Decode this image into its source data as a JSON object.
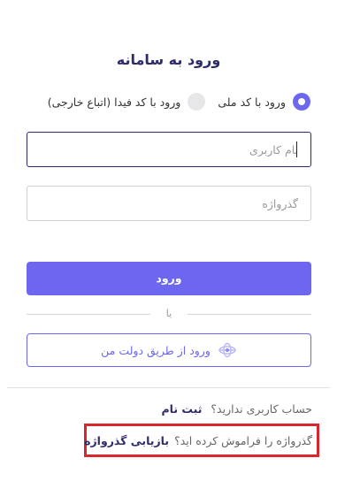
{
  "login": {
    "title": "ورود به سامانه",
    "radio_options": [
      {
        "label": "ورود با کد ملی",
        "selected": true
      },
      {
        "label": "ورود با کد فیدا (اتباع خارجی)",
        "selected": false
      }
    ],
    "username_placeholder": "نام کاربری",
    "password_placeholder": "گذرواژه",
    "submit_label": "ورود",
    "divider_text": "یا",
    "gov_login_label": "ورود از طریق دولت من"
  },
  "footer": {
    "no_account_text": "حساب کاربری ندارید؟",
    "signup_link": "ثبت نام",
    "forgot_text": "گذرواژه را فراموش کرده اید؟",
    "recover_link": "بازیابی گذرواژه"
  },
  "colors": {
    "accent": "#6d67f0",
    "title": "#2f2c6b",
    "highlight_border": "#d8262c"
  }
}
